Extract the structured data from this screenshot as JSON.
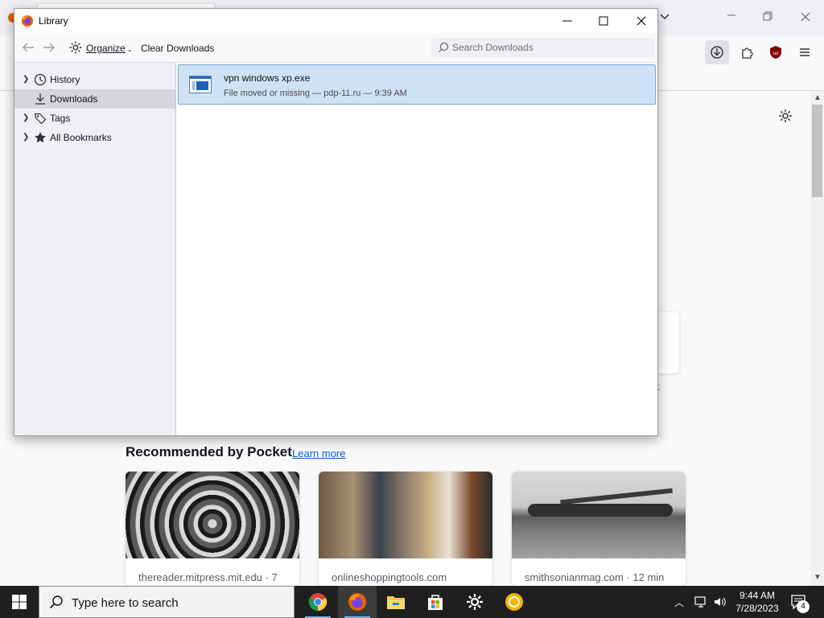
{
  "library": {
    "title": "Library",
    "toolbar": {
      "organize_label": "Organize",
      "clear_label": "Clear Downloads",
      "search_placeholder": "Search Downloads"
    },
    "sidebar": {
      "items": [
        {
          "label": "History",
          "icon": "clock-icon"
        },
        {
          "label": "Downloads",
          "icon": "download-icon"
        },
        {
          "label": "Tags",
          "icon": "tag-icon"
        },
        {
          "label": "All Bookmarks",
          "icon": "star-icon"
        }
      ]
    },
    "downloads": [
      {
        "name": "vpn windows xp.exe",
        "status": "File moved or missing — pdp-11.ru — 9:39 AM"
      }
    ]
  },
  "newtab": {
    "pocket_title": "Recommended by Pocket",
    "learn_more": "Learn more",
    "cards": [
      {
        "source": "thereader.mitpress.mit.edu · 7"
      },
      {
        "source": "onlineshoppingtools.com"
      },
      {
        "source": "smithsonianmag.com · 12 min"
      }
    ],
    "peek_text": "t"
  },
  "taskbar": {
    "search_placeholder": "Type here to search",
    "time": "9:44 AM",
    "date": "7/28/2023",
    "notification_count": "4"
  },
  "colors": {
    "accent": "#0061e0",
    "selection": "#cfe2f5",
    "taskbar": "#1f1f1f"
  }
}
